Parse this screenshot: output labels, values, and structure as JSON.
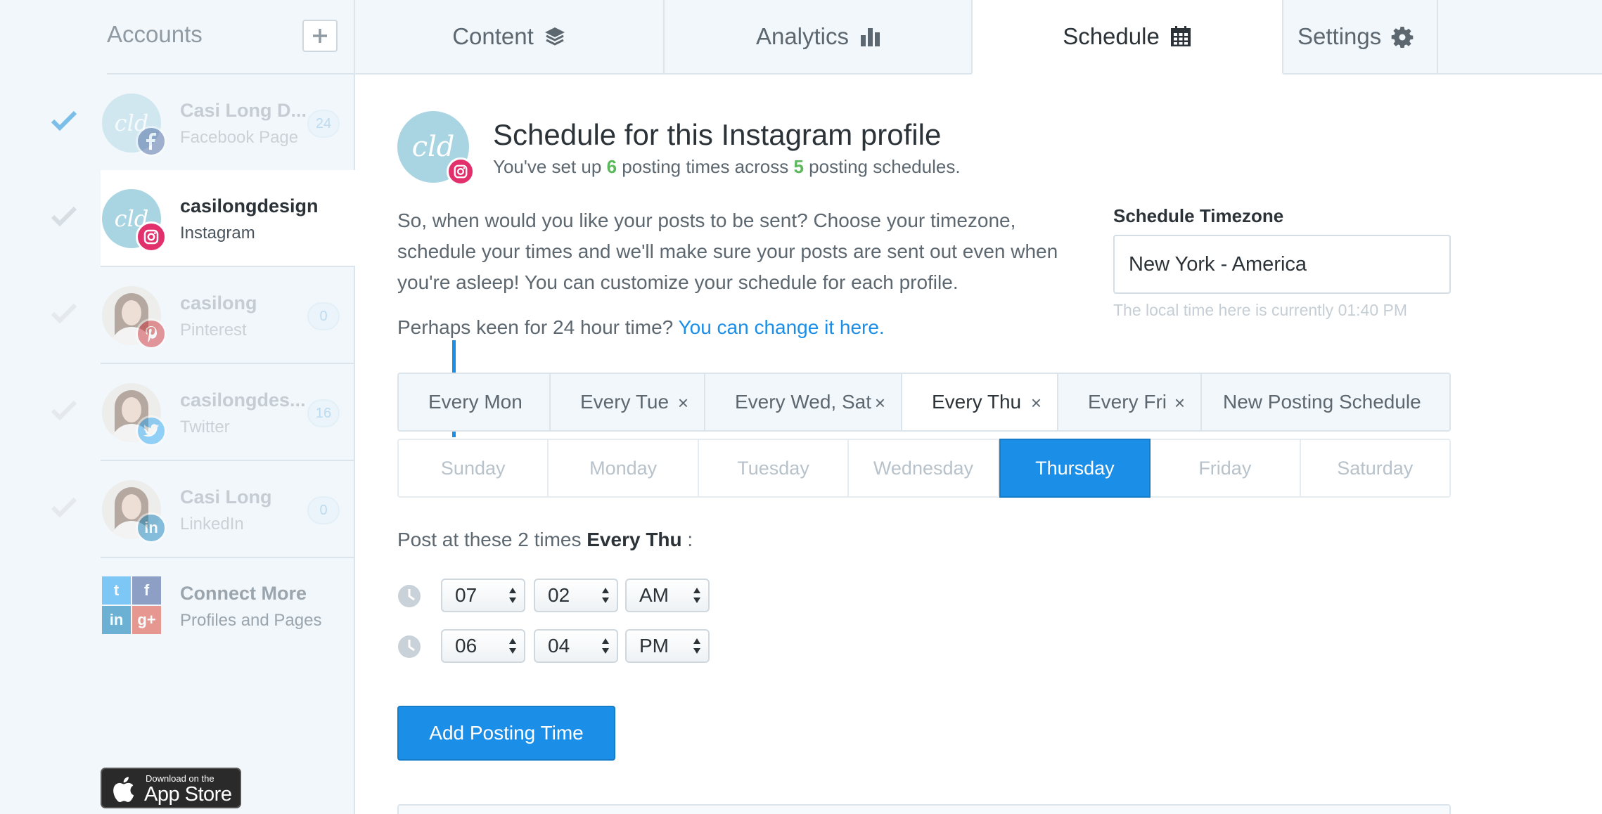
{
  "sidebar": {
    "title": "Accounts",
    "add_icon": "plus-icon",
    "accounts": [
      {
        "name": "Casi Long D...",
        "type": "Facebook Page",
        "count": "24",
        "network": "facebook",
        "badge_color": "#3b5998"
      },
      {
        "name": "casilongdesign",
        "type": "Instagram",
        "count": "",
        "network": "instagram",
        "badge_color": "#e1306c"
      },
      {
        "name": "casilong",
        "type": "Pinterest",
        "count": "0",
        "network": "pinterest",
        "badge_color": "#cb2027"
      },
      {
        "name": "casilongdes...",
        "type": "Twitter",
        "count": "16",
        "network": "twitter",
        "badge_color": "#1da1f2"
      },
      {
        "name": "Casi Long",
        "type": "LinkedIn",
        "count": "0",
        "network": "linkedin",
        "badge_color": "#0077b5"
      }
    ],
    "connect": {
      "title": "Connect More",
      "subtitle": "Profiles and Pages"
    },
    "appstore": {
      "small": "Download on the",
      "big": "App Store"
    }
  },
  "tabs": [
    {
      "label": "Content",
      "icon": "layers-icon"
    },
    {
      "label": "Analytics",
      "icon": "bar-chart-icon"
    },
    {
      "label": "Schedule",
      "icon": "calendar-icon",
      "active": true
    },
    {
      "label": "Settings",
      "icon": "gear-icon"
    }
  ],
  "main": {
    "title": "Schedule for this Instagram profile",
    "sub_pre": "You've set up ",
    "sub_times": "6",
    "sub_mid": " posting times across ",
    "sub_schedules": "5",
    "sub_post": " posting schedules.",
    "intro": "So, when would you like your posts to be sent? Choose your timezone, schedule your times and we'll make sure your posts are sent out even when you're asleep! You can customize your schedule for each profile.",
    "hour_pre": "Perhaps keen for 24 hour time? ",
    "hour_link": "You can change it here.",
    "timezone": {
      "label": "Schedule Timezone",
      "value": "New York - America",
      "note": "The local time here is currently 01:40 PM"
    },
    "schedules": [
      {
        "label": "Every Mon",
        "closable": false
      },
      {
        "label": "Every Tue",
        "closable": true
      },
      {
        "label": "Every Wed, Sat",
        "closable": true
      },
      {
        "label": "Every Thu",
        "closable": true,
        "active": true
      },
      {
        "label": "Every Fri",
        "closable": true
      },
      {
        "label": "New Posting Schedule",
        "closable": false
      }
    ],
    "close_glyph": "×",
    "days": [
      "Sunday",
      "Monday",
      "Tuesday",
      "Wednesday",
      "Thursday",
      "Friday",
      "Saturday"
    ],
    "active_day": "Thursday",
    "post_pre": "Post at these 2 times ",
    "post_bold": "Every Thu",
    "post_post": " :",
    "times": [
      {
        "hour": "07",
        "minute": "02",
        "ampm": "AM"
      },
      {
        "hour": "06",
        "minute": "04",
        "ampm": "PM"
      }
    ],
    "add_button": "Add Posting Time"
  },
  "colors": {
    "accent": "#1b8ee8",
    "green": "#5cb85c",
    "sidebar_bg": "#f2f7fb"
  }
}
